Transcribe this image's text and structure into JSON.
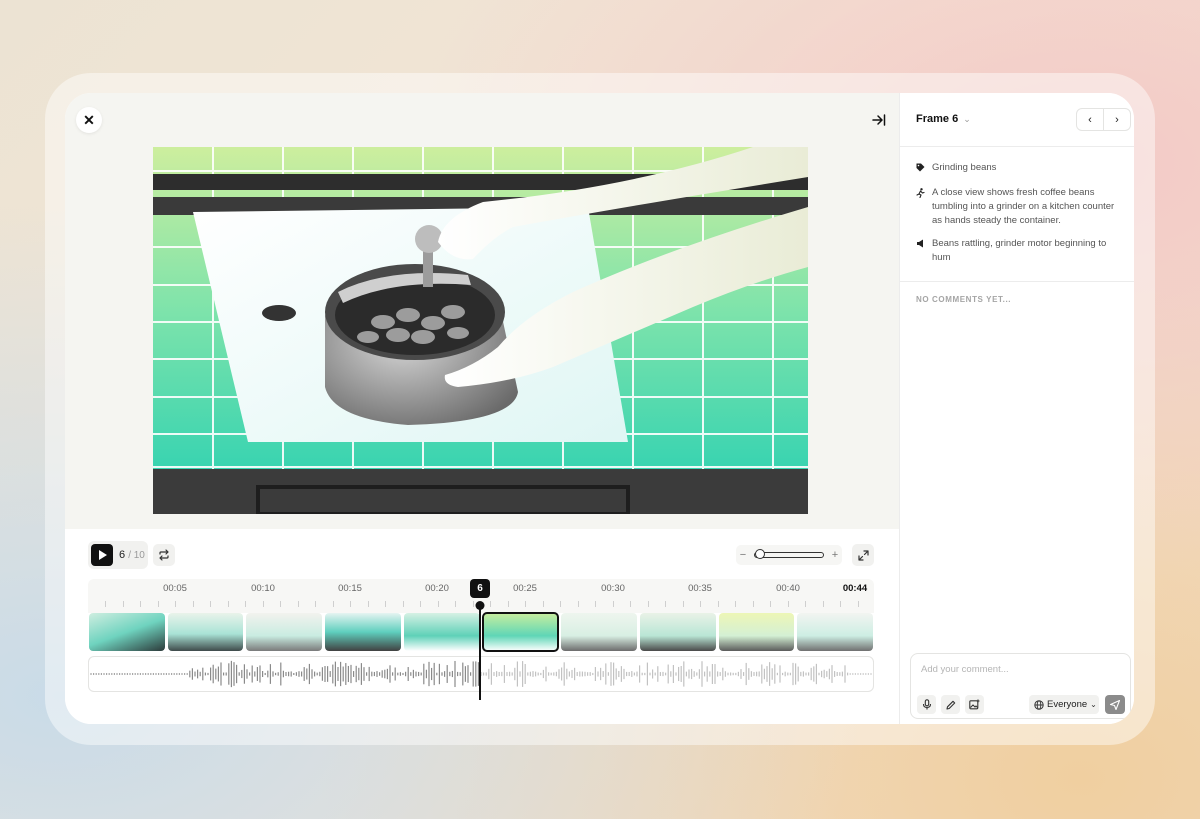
{
  "toolbar": {
    "close_icon": "close-icon",
    "collapse_icon": "collapse-panel-icon"
  },
  "player": {
    "current_frame": "6",
    "total_frames": "/ 10",
    "zoom_minus": "−",
    "zoom_plus": "+",
    "zoom_level": 0.05
  },
  "timeline": {
    "labels": [
      "00:05",
      "00:10",
      "00:15",
      "00:20",
      "00:25",
      "00:30",
      "00:35",
      "00:40",
      "00:44"
    ],
    "playhead_frame": "6",
    "active_thumb": 5,
    "thumbs": [
      {
        "name": "thumb-1"
      },
      {
        "name": "thumb-2"
      },
      {
        "name": "thumb-3"
      },
      {
        "name": "thumb-4"
      },
      {
        "name": "thumb-5"
      },
      {
        "name": "thumb-6"
      },
      {
        "name": "thumb-7"
      },
      {
        "name": "thumb-8"
      },
      {
        "name": "thumb-9"
      },
      {
        "name": "thumb-10"
      }
    ]
  },
  "sidebar": {
    "frame_title": "Frame 6",
    "prev_icon": "chevron-left-icon",
    "next_icon": "chevron-right-icon",
    "tag": "Grinding beans",
    "action": "A close view shows fresh coffee beans tumbling into a grinder on a kitchen counter as hands steady the container.",
    "sound": "Beans rattling, grinder motor beginning to hum",
    "no_comments": "NO COMMENTS YET...",
    "comment_placeholder": "Add your comment...",
    "audience": "Everyone"
  },
  "colors": {
    "accent": "#111111",
    "tile": "#2fd1b0",
    "tile_light": "#c8ec9c"
  }
}
